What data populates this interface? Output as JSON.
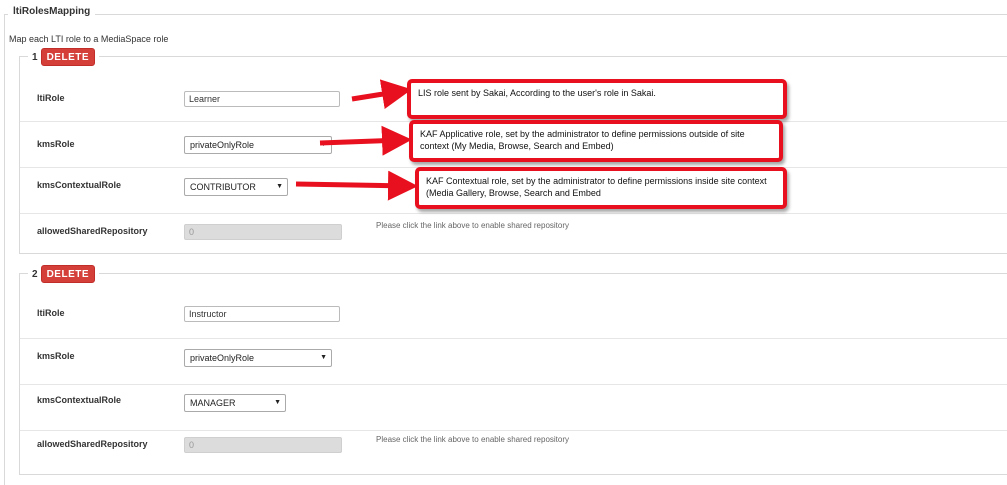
{
  "section": {
    "title": "ltiRolesMapping",
    "description": "Map each LTI role to a MediaSpace role"
  },
  "groups": [
    {
      "number": "1",
      "delete_label": "DELETE",
      "fields": {
        "ltiRole": {
          "label": "ltiRole",
          "value": "Learner"
        },
        "kmsRole": {
          "label": "kmsRole",
          "value": "privateOnlyRole"
        },
        "kmsContextualRole": {
          "label": "kmsContextualRole",
          "value": "CONTRIBUTOR"
        },
        "allowedSharedRepository": {
          "label": "allowedSharedRepository",
          "value": "0",
          "helper": "Please click the link above to enable shared repository"
        }
      }
    },
    {
      "number": "2",
      "delete_label": "DELETE",
      "fields": {
        "ltiRole": {
          "label": "ltiRole",
          "value": "Instructor"
        },
        "kmsRole": {
          "label": "kmsRole",
          "value": "privateOnlyRole"
        },
        "kmsContextualRole": {
          "label": "kmsContextualRole",
          "value": "MANAGER"
        },
        "allowedSharedRepository": {
          "label": "allowedSharedRepository",
          "value": "0",
          "helper": "Please click the link above to enable shared repository"
        }
      }
    }
  ],
  "callouts": [
    {
      "text": "LIS role sent by Sakai, According to the user's role in Sakai."
    },
    {
      "text": "KAF Applicative role, set by the administrator to define permissions outside of site context (My Media, Browse, Search and Embed)"
    },
    {
      "text": "KAF Contextual role, set by the administrator to define permissions inside site context (Media Gallery, Browse, Search and Embed"
    }
  ],
  "colors": {
    "delete_button": "#d43f3a",
    "callout_border": "#e8101e",
    "arrow": "#e8101e"
  },
  "icons": {
    "select_arrow": "caret-down-icon"
  }
}
